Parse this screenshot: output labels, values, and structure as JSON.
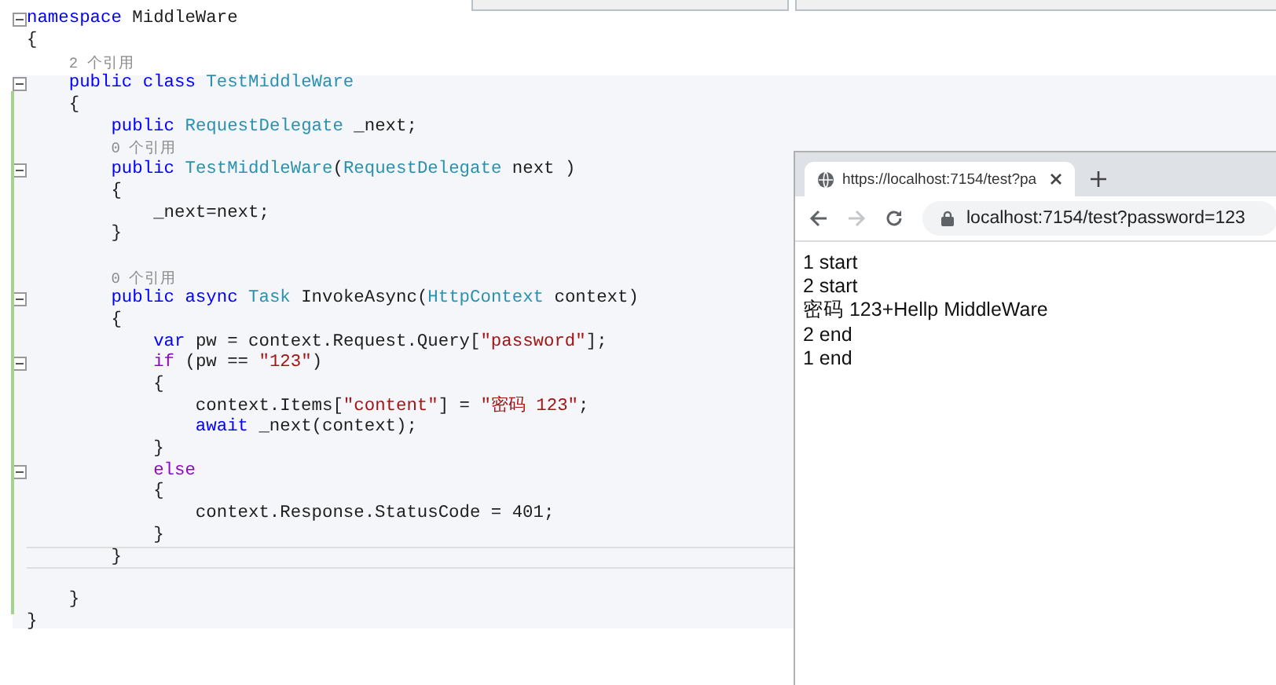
{
  "editor": {
    "lines": [
      {
        "kind": "code",
        "fold": true,
        "current": false,
        "tokens": [
          {
            "t": "namespace",
            "kind": "kw"
          },
          {
            "t": " MiddleWare",
            "kind": "plain"
          }
        ]
      },
      {
        "kind": "code",
        "fold": false,
        "current": false,
        "tokens": [
          {
            "t": "{",
            "kind": "plain"
          }
        ]
      },
      {
        "kind": "lens",
        "fold": false,
        "current": false,
        "tokens": [
          {
            "t": "    2 个引用",
            "kind": "lens"
          }
        ]
      },
      {
        "kind": "code",
        "fold": true,
        "current": false,
        "tokens": [
          {
            "t": "    public class",
            "kind": "kw"
          },
          {
            "t": " TestMiddleWare",
            "kind": "type"
          }
        ]
      },
      {
        "kind": "code",
        "fold": false,
        "current": false,
        "tokens": [
          {
            "t": "    {",
            "kind": "plain"
          }
        ]
      },
      {
        "kind": "code",
        "fold": false,
        "current": false,
        "tokens": [
          {
            "t": "        public",
            "kind": "kw"
          },
          {
            "t": " RequestDelegate",
            "kind": "type"
          },
          {
            "t": " _next;",
            "kind": "plain"
          }
        ]
      },
      {
        "kind": "lens",
        "fold": false,
        "current": false,
        "tokens": [
          {
            "t": "        0 个引用",
            "kind": "lens"
          }
        ]
      },
      {
        "kind": "code",
        "fold": true,
        "current": false,
        "tokens": [
          {
            "t": "        public",
            "kind": "kw"
          },
          {
            "t": " TestMiddleWare",
            "kind": "type"
          },
          {
            "t": "(",
            "kind": "plain"
          },
          {
            "t": "RequestDelegate",
            "kind": "type"
          },
          {
            "t": " next )",
            "kind": "plain"
          }
        ]
      },
      {
        "kind": "code",
        "fold": false,
        "current": false,
        "tokens": [
          {
            "t": "        {",
            "kind": "plain"
          }
        ]
      },
      {
        "kind": "code",
        "fold": false,
        "current": false,
        "tokens": [
          {
            "t": "            _next=next;",
            "kind": "plain"
          }
        ]
      },
      {
        "kind": "code",
        "fold": false,
        "current": false,
        "tokens": [
          {
            "t": "        }",
            "kind": "plain"
          }
        ]
      },
      {
        "kind": "blank",
        "fold": false,
        "current": false
      },
      {
        "kind": "lens",
        "fold": false,
        "current": false,
        "tokens": [
          {
            "t": "        0 个引用",
            "kind": "lens"
          }
        ]
      },
      {
        "kind": "code",
        "fold": true,
        "current": false,
        "tokens": [
          {
            "t": "        public async",
            "kind": "kw"
          },
          {
            "t": " Task",
            "kind": "type"
          },
          {
            "t": " InvokeAsync(",
            "kind": "plain"
          },
          {
            "t": "HttpContext",
            "kind": "type"
          },
          {
            "t": " context)",
            "kind": "plain"
          }
        ]
      },
      {
        "kind": "code",
        "fold": false,
        "current": false,
        "tokens": [
          {
            "t": "        {",
            "kind": "plain"
          }
        ]
      },
      {
        "kind": "code",
        "fold": false,
        "current": false,
        "tokens": [
          {
            "t": "            var",
            "kind": "kw"
          },
          {
            "t": " pw = context.Request.Query[",
            "kind": "plain"
          },
          {
            "t": "\"password\"",
            "kind": "str"
          },
          {
            "t": "];",
            "kind": "plain"
          }
        ]
      },
      {
        "kind": "code",
        "fold": true,
        "current": false,
        "tokens": [
          {
            "t": "            if",
            "kind": "ctl"
          },
          {
            "t": " (pw == ",
            "kind": "plain"
          },
          {
            "t": "\"123\"",
            "kind": "str"
          },
          {
            "t": ")",
            "kind": "plain"
          }
        ]
      },
      {
        "kind": "code",
        "fold": false,
        "current": false,
        "tokens": [
          {
            "t": "            {",
            "kind": "plain"
          }
        ]
      },
      {
        "kind": "code",
        "fold": false,
        "current": false,
        "tokens": [
          {
            "t": "                context.Items[",
            "kind": "plain"
          },
          {
            "t": "\"content\"",
            "kind": "str"
          },
          {
            "t": "] = ",
            "kind": "plain"
          },
          {
            "t": "\"密码 123\"",
            "kind": "str"
          },
          {
            "t": ";",
            "kind": "plain"
          }
        ]
      },
      {
        "kind": "code",
        "fold": false,
        "current": false,
        "tokens": [
          {
            "t": "                await",
            "kind": "kw"
          },
          {
            "t": " _next(context);",
            "kind": "plain"
          }
        ]
      },
      {
        "kind": "code",
        "fold": false,
        "current": false,
        "tokens": [
          {
            "t": "            }",
            "kind": "plain"
          }
        ]
      },
      {
        "kind": "code",
        "fold": true,
        "current": false,
        "tokens": [
          {
            "t": "            else",
            "kind": "ctl"
          }
        ]
      },
      {
        "kind": "code",
        "fold": false,
        "current": false,
        "tokens": [
          {
            "t": "            {",
            "kind": "plain"
          }
        ]
      },
      {
        "kind": "code",
        "fold": false,
        "current": false,
        "tokens": [
          {
            "t": "                context.Response.StatusCode = 401;",
            "kind": "plain"
          }
        ]
      },
      {
        "kind": "code",
        "fold": false,
        "current": false,
        "tokens": [
          {
            "t": "            }",
            "kind": "plain"
          }
        ]
      },
      {
        "kind": "code",
        "fold": false,
        "current": true,
        "tokens": [
          {
            "t": "        }",
            "kind": "plain"
          }
        ]
      },
      {
        "kind": "blank",
        "fold": false,
        "current": false
      },
      {
        "kind": "code",
        "fold": false,
        "current": false,
        "tokens": [
          {
            "t": "    }",
            "kind": "plain"
          }
        ]
      },
      {
        "kind": "code",
        "fold": false,
        "current": false,
        "tokens": [
          {
            "t": "}",
            "kind": "plain"
          }
        ]
      }
    ]
  },
  "browser": {
    "tab": {
      "title": "https://localhost:7154/test?pa",
      "selected": true
    },
    "nav": {
      "forward_disabled": true
    },
    "address": "localhost:7154/test?password=123",
    "output": [
      "1 start",
      "2 start",
      "密码 123+Hellp MiddleWare",
      "2 end",
      "1 end"
    ]
  }
}
